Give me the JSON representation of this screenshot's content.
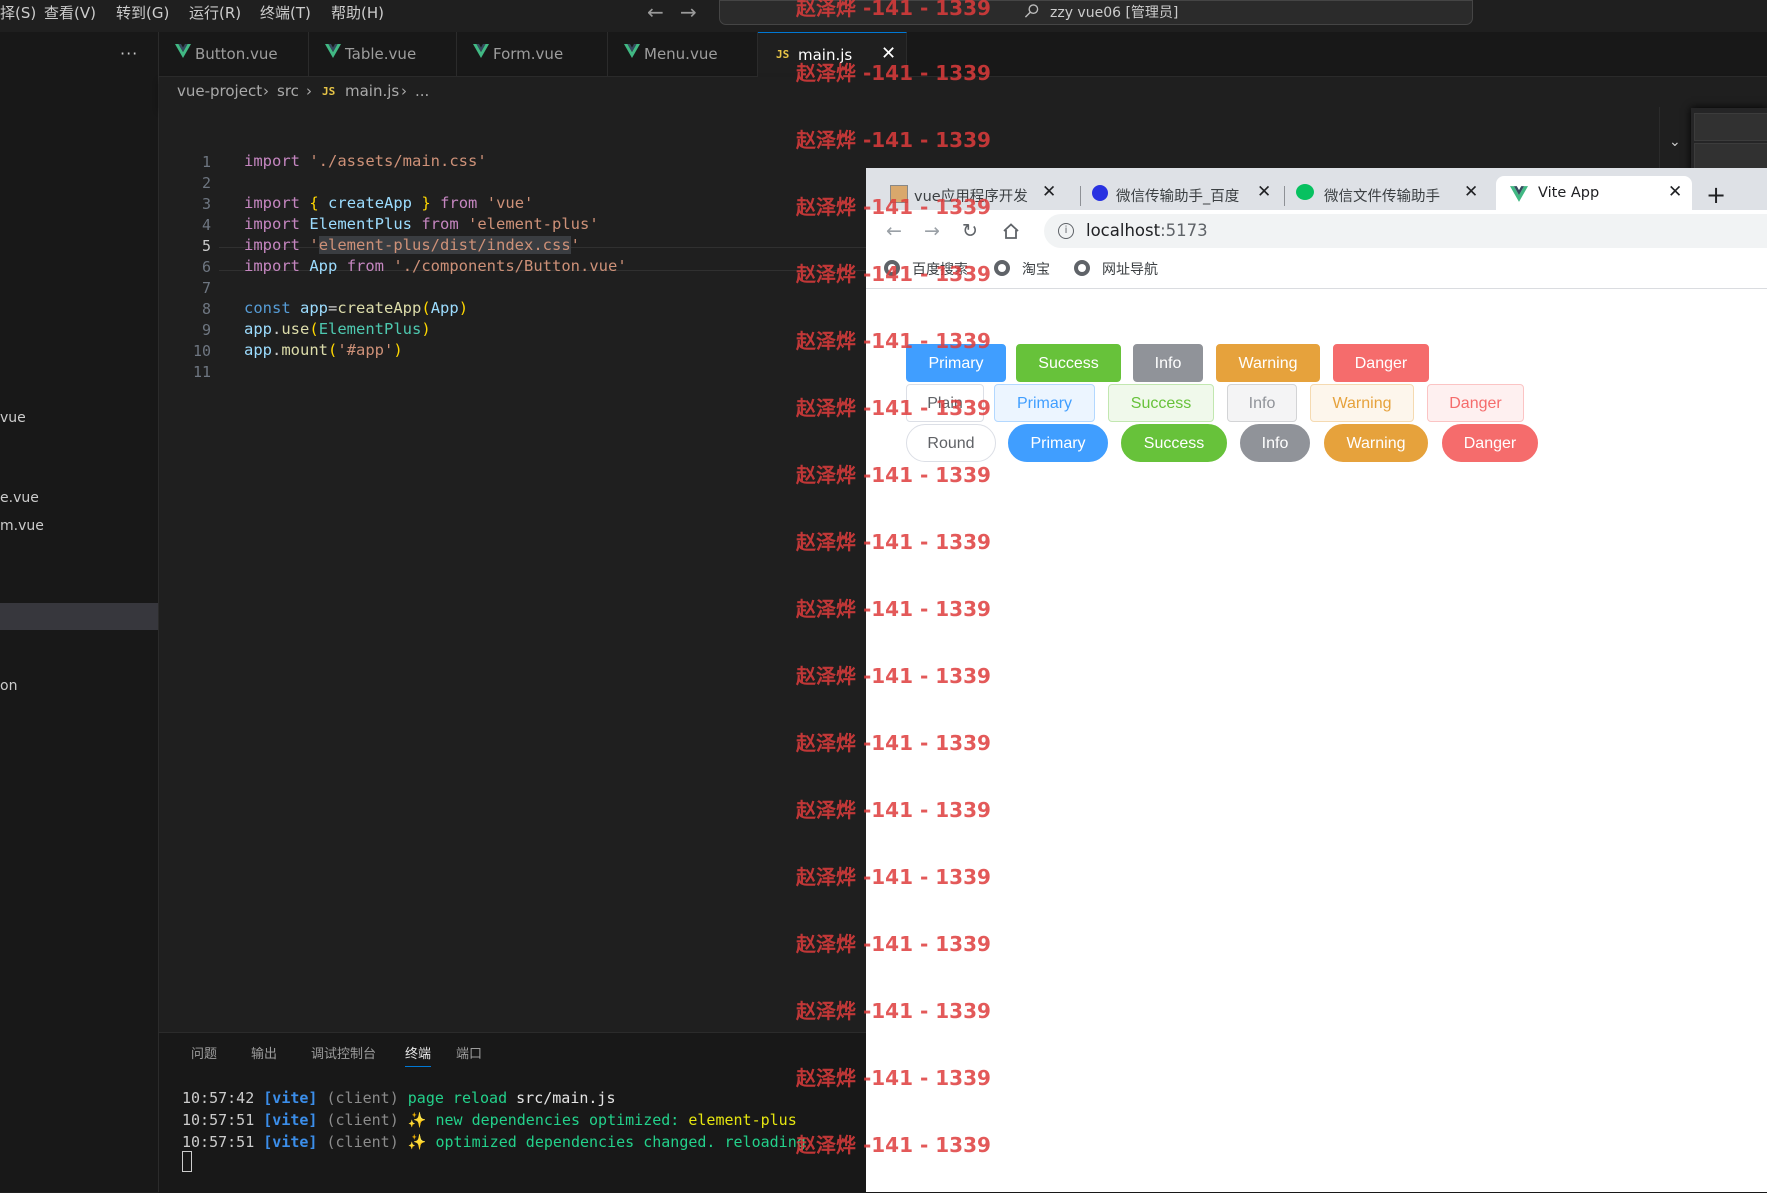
{
  "menubar": {
    "items": [
      "择(S)",
      "查看(V)",
      "转到(G)",
      "运行(R)",
      "终端(T)",
      "帮助(H)"
    ],
    "command_center": "zzy vue06 [管理员]"
  },
  "sidebar": {
    "more": "···",
    "files": [
      "vue",
      "e.vue",
      "m.vue",
      "on"
    ]
  },
  "tabs": [
    {
      "label": "Button.vue",
      "icon": "vue-icon"
    },
    {
      "label": "Table.vue",
      "icon": "vue-icon"
    },
    {
      "label": "Form.vue",
      "icon": "vue-icon"
    },
    {
      "label": "Menu.vue",
      "icon": "vue-icon"
    },
    {
      "label": "main.js",
      "icon": "js-icon",
      "badge": "JS",
      "active": true
    }
  ],
  "breadcrumb": {
    "project": "vue-project",
    "folder": "src",
    "file_badge": "JS",
    "file": "main.js",
    "more": "..."
  },
  "editor": {
    "line_numbers": [
      "1",
      "2",
      "3",
      "4",
      "5",
      "6",
      "7",
      "8",
      "9",
      "10",
      "11"
    ],
    "current_line": "5",
    "lines": {
      "l1": {
        "kw": "import",
        "str": "'./assets/main.css'"
      },
      "l3": {
        "kw": "import",
        "open": "{",
        "name": "createApp",
        "close": "}",
        "from": "from",
        "str": "'vue'"
      },
      "l4": {
        "kw": "import",
        "name": "ElementPlus",
        "from": "from",
        "str": "'element-plus'"
      },
      "l5": {
        "kw": "import",
        "q1": "'",
        "path": "element-plus/dist/index.css",
        "q2": "'"
      },
      "l6": {
        "kw": "import",
        "name": "App",
        "from": "from",
        "str": "'./components/Button.vue'"
      },
      "l8": {
        "kw": "const",
        "var": "app",
        "eq": "=",
        "fn": "createApp",
        "p1": "(",
        "arg": "App",
        "p2": ")"
      },
      "l9": {
        "obj": "app",
        "dot": ".",
        "fn": "use",
        "p1": "(",
        "arg": "ElementPlus",
        "p2": ")"
      },
      "l10": {
        "obj": "app",
        "dot": ".",
        "fn": "mount",
        "p1": "(",
        "arg": "'#app'",
        "p2": ")"
      }
    }
  },
  "panel": {
    "tabs": [
      "问题",
      "输出",
      "调试控制台",
      "终端",
      "端口"
    ],
    "active_tab": "终端",
    "terminal": [
      {
        "time": "10:57:42",
        "tag": "[vite]",
        "src": "(client)",
        "msg": "page reload",
        "file": "src/main.js"
      },
      {
        "time": "10:57:51",
        "tag": "[vite]",
        "src": "(client)",
        "sparkle": "✨",
        "msg": "new dependencies optimized:",
        "file": "element-plus"
      },
      {
        "time": "10:57:51",
        "tag": "[vite]",
        "src": "(client)",
        "sparkle": "✨",
        "msg": "optimized dependencies changed. reloading",
        "file": ""
      }
    ]
  },
  "browser": {
    "tabs": [
      {
        "label": "vue应用程序开发",
        "icon": "page-icon"
      },
      {
        "label": "微信传输助手_百度",
        "icon": "baidu-icon"
      },
      {
        "label": "微信文件传输助手",
        "icon": "wechat-icon"
      },
      {
        "label": "Vite App",
        "icon": "vite-icon",
        "active": true
      }
    ],
    "new_tab": "+",
    "url_host": "localhost",
    "url_port": ":5173",
    "bookmarks": [
      "百度搜索",
      "淘宝",
      "网址导航"
    ],
    "buttons": {
      "row1": [
        "Primary",
        "Success",
        "Info",
        "Warning",
        "Danger"
      ],
      "row2": [
        "Plain",
        "Primary",
        "Success",
        "Info",
        "Warning",
        "Danger"
      ],
      "row3": [
        "Round",
        "Primary",
        "Success",
        "Info",
        "Warning",
        "Danger"
      ]
    }
  },
  "watermark": "赵泽烨 -141 - 1339",
  "colors": {
    "primary": "#409eff",
    "success": "#67c23a",
    "info": "#909399",
    "warning": "#e6a23c",
    "danger": "#f56c6c",
    "vscode_accent": "#0078d4"
  }
}
